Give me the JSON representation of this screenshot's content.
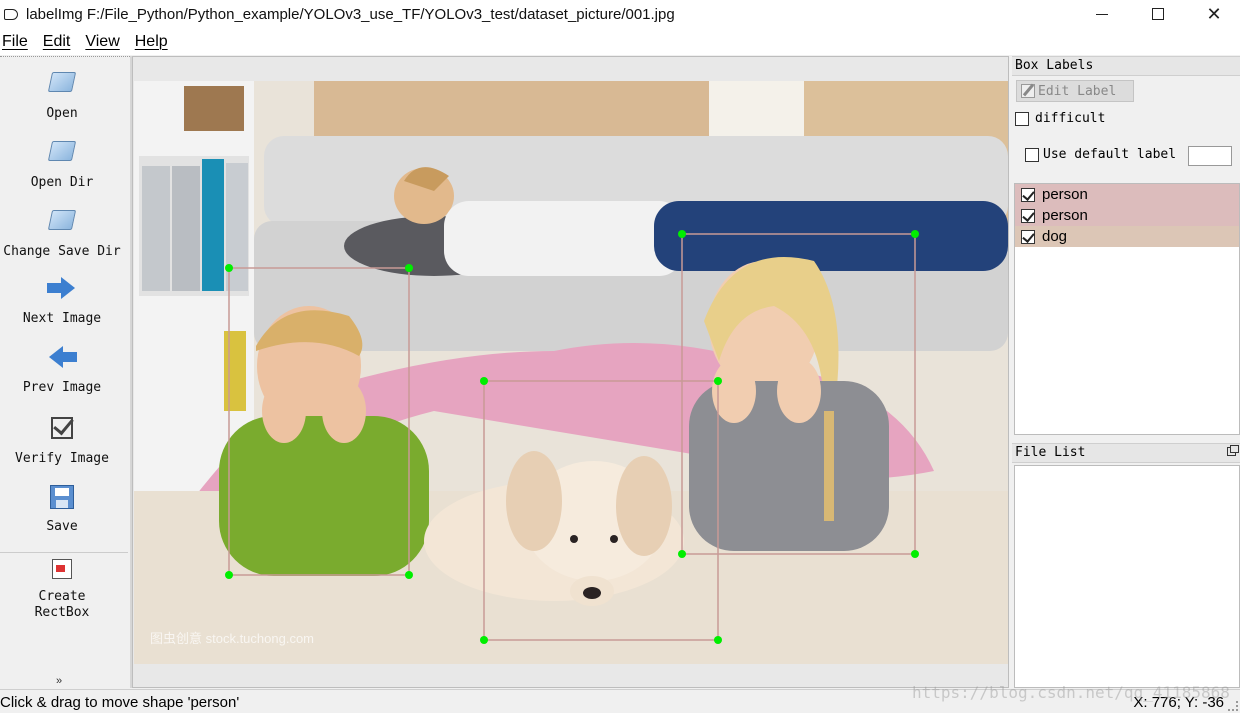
{
  "window": {
    "title": "labelImg F:/File_Python/Python_example/YOLOv3_use_TF/YOLOv3_test/dataset_picture/001.jpg",
    "controls": [
      "minimize",
      "maximize",
      "close"
    ]
  },
  "menu": [
    "File",
    "Edit",
    "View",
    "Help"
  ],
  "toolbar": {
    "open": "Open",
    "open_dir": "Open Dir",
    "change_save_dir": "Change Save Dir",
    "next_image": "Next Image",
    "prev_image": "Prev Image",
    "verify_image": "Verify Image",
    "save": "Save",
    "create_rectbox_line1": "Create",
    "create_rectbox_line2": "RectBox",
    "more": "»"
  },
  "canvas": {
    "watermark": "图虫创意 stock.tuchong.com",
    "shapes": [
      {
        "label": "person",
        "selected": true
      },
      {
        "label": "person",
        "selected": false
      },
      {
        "label": "dog",
        "selected": false
      }
    ]
  },
  "box_labels": {
    "title": "Box Labels",
    "edit_label": "Edit Label",
    "difficult": "difficult",
    "difficult_checked": false,
    "use_default_label": "Use default label",
    "use_default_checked": false,
    "default_label_value": "",
    "items": [
      {
        "label": "person",
        "checked": true,
        "color": "#dcbcbc"
      },
      {
        "label": "person",
        "checked": true,
        "color": "#dcbcbc"
      },
      {
        "label": "dog",
        "checked": true,
        "color": "#dcc6b6"
      }
    ]
  },
  "file_list": {
    "title": "File List",
    "items": []
  },
  "status": {
    "message": "Click & drag to move shape 'person'",
    "coords": "X: 776; Y: -36"
  },
  "page_watermark": "https://blog.csdn.net/qq_41185868",
  "colors": {
    "vertex": "#00ee00",
    "box_line": "#c89a96",
    "accent_arrow": "#3c7fd0"
  }
}
